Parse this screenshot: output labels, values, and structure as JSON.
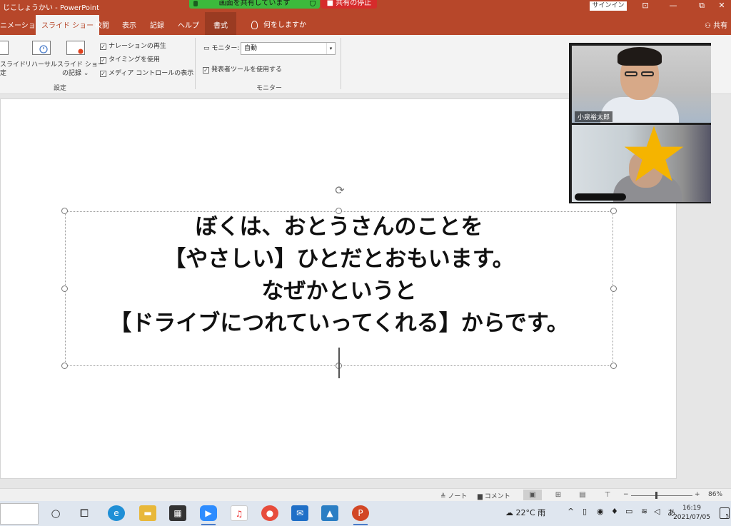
{
  "titlebar": {
    "doc_title": "じこしょうかい  -  PowerPoint",
    "share_banner": "画面を共有しています",
    "stop_banner": "■ 共有の停止",
    "signin": "サインイン",
    "btn_ribbon_display": "⊡",
    "btn_minimize": "—",
    "btn_restore": "⧉",
    "btn_close": "✕"
  },
  "tabs": {
    "animation": "ニメーション",
    "slideshow": "スライド ショー",
    "review": "校閲",
    "view": "表示",
    "record": "記録",
    "help": "ヘルプ",
    "format": "書式",
    "tell_me": "何をしますか",
    "share": "共有"
  },
  "ribbon": {
    "setup_partial_line1": "スライド",
    "setup_partial_line2": "定",
    "rehearse": "リハーサル",
    "record_line1": "スライド ショー",
    "record_line2": "の記録 ⌄",
    "chk_narration": "ナレーションの再生",
    "chk_timing": "タイミングを使用",
    "chk_media": "メディア コントロールの表示",
    "group_setup": "設定",
    "monitor_label": "モニター:",
    "monitor_value": "自動",
    "chk_presenter": "発表者ツールを使用する",
    "group_monitor": "モニター"
  },
  "slide": {
    "lines": [
      "ぼくは、おとうさんのことを",
      "【やさしい】ひとだとおもいます。",
      "なぜかというと",
      "【ドライブにつれていってくれる】からです。"
    ]
  },
  "video": {
    "participant1": "小泉裕太郎"
  },
  "statusbar": {
    "notes": "ノート",
    "comments": "コメント",
    "zoom_minus": "−",
    "zoom_plus": "+",
    "zoom_level": "86%"
  },
  "taskbar": {
    "weather": "22°C 雨",
    "ime": "あ",
    "time": "16:19",
    "date": "2021/07/05",
    "notifications": "5"
  },
  "colors": {
    "accent": "#b7472a",
    "share_green": "#3cba3c",
    "stop_red": "#d62b2b",
    "star": "#f5b400"
  }
}
